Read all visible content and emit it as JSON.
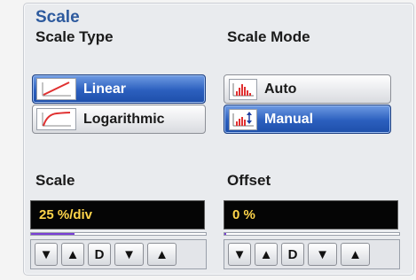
{
  "title": "Scale",
  "scale_type": {
    "label": "Scale Type",
    "options": [
      {
        "label": "Linear",
        "icon": "linear-graph-icon",
        "selected": true
      },
      {
        "label": "Logarithmic",
        "icon": "log-graph-icon",
        "selected": false
      }
    ]
  },
  "scale_mode": {
    "label": "Scale Mode",
    "options": [
      {
        "label": "Auto",
        "icon": "auto-histogram-icon",
        "selected": false
      },
      {
        "label": "Manual",
        "icon": "manual-histogram-icon",
        "selected": true
      }
    ]
  },
  "scale": {
    "label": "Scale",
    "value": "25 %/div",
    "level": 0.25,
    "stepper": {
      "fine_down": "▼",
      "fine_up": "▲",
      "default": "D",
      "coarse_down": "▼",
      "coarse_up": "▲"
    }
  },
  "offset": {
    "label": "Offset",
    "value": "0 %",
    "level": 0.01,
    "stepper": {
      "fine_down": "▼",
      "fine_up": "▲",
      "default": "D",
      "coarse_down": "▼",
      "coarse_up": "▲"
    }
  },
  "colors": {
    "title": "#2d5a9e",
    "selected": "#2b5fbe",
    "readout_text": "#ffd54a",
    "progress": "#7a3ed6"
  }
}
